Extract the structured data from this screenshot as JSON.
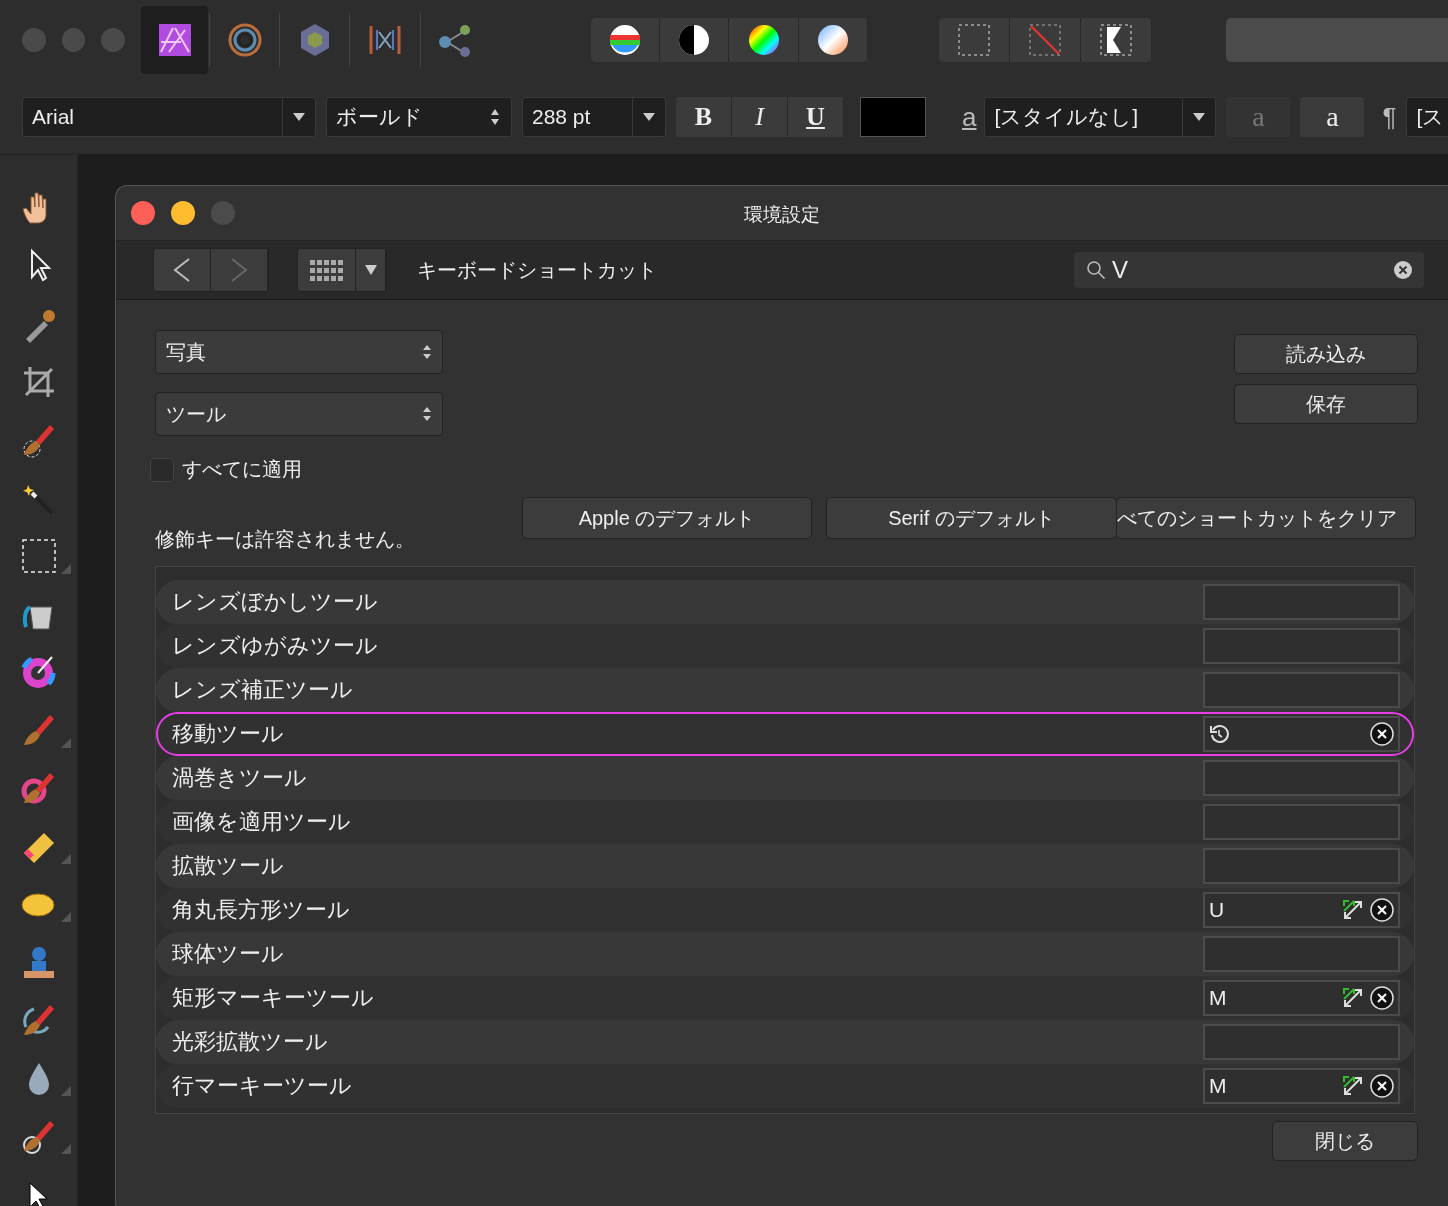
{
  "app_toolbar": {
    "personas": [
      {
        "selected": true
      },
      {
        "selected": false
      },
      {
        "selected": false
      },
      {
        "selected": false
      },
      {
        "selected": false
      }
    ]
  },
  "context_toolbar": {
    "font": "Arial",
    "weight": "ボールド",
    "size": "288 pt",
    "style_buttons": [
      "B",
      "I",
      "U"
    ],
    "character_style_glyph": "a",
    "paragraph_style": "[スタイルなし]",
    "glyph_buttons": [
      {
        "label": "a",
        "disabled": true
      },
      {
        "label": "a",
        "disabled": false
      }
    ],
    "pilcrow": "¶",
    "overflow_field": "[ス"
  },
  "dialog": {
    "title": "環境設定",
    "nav": {
      "forward_disabled": true
    },
    "section": "キーボードショートカット",
    "search": {
      "value": "V"
    },
    "app_popup": "写真",
    "category_popup": "ツール",
    "apply_all": {
      "label": "すべてに適用",
      "checked": false
    },
    "side_buttons": [
      "読み込み",
      "保存"
    ],
    "default_buttons": [
      "Apple のデフォルト",
      "Serif のデフォルト",
      "べてのショートカットをクリア"
    ],
    "note": "修飾キーは許容されません。",
    "rows": [
      {
        "name": "レンズぼかしツール",
        "kind": "empty",
        "highlighted": false
      },
      {
        "name": "レンズゆがみツール",
        "kind": "empty",
        "highlighted": false
      },
      {
        "name": "レンズ補正ツール",
        "kind": "empty",
        "highlighted": false
      },
      {
        "name": "移動ツール",
        "kind": "editing",
        "highlighted": true
      },
      {
        "name": "渦巻きツール",
        "kind": "empty",
        "highlighted": false
      },
      {
        "name": "画像を適用ツール",
        "kind": "empty",
        "highlighted": false
      },
      {
        "name": "拡散ツール",
        "kind": "empty",
        "highlighted": false
      },
      {
        "name": "角丸長方形ツール",
        "kind": "assigned",
        "shortcut": "U",
        "highlighted": false
      },
      {
        "name": "球体ツール",
        "kind": "empty",
        "highlighted": false
      },
      {
        "name": "矩形マーキーツール",
        "kind": "assigned",
        "shortcut": "M",
        "highlighted": false
      },
      {
        "name": "光彩拡散ツール",
        "kind": "empty",
        "highlighted": false
      },
      {
        "name": "行マーキーツール",
        "kind": "assigned",
        "shortcut": "M",
        "highlighted": false
      }
    ],
    "close_button": "閉じる"
  }
}
